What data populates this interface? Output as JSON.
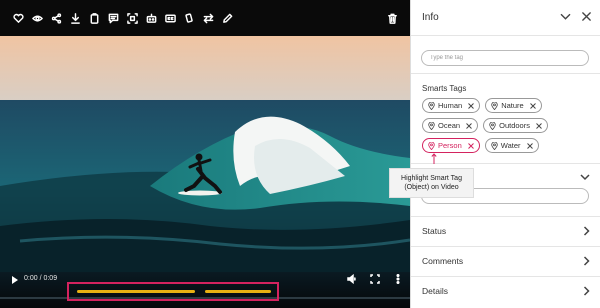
{
  "toolbar": {
    "icons": [
      "heart-icon",
      "eye-icon",
      "share-icon",
      "download-icon",
      "clipboard-icon",
      "comment-icon",
      "crop-icon",
      "bot-icon",
      "caption-icon",
      "rotate-icon",
      "swap-icon",
      "edit-icon",
      "trash-icon"
    ]
  },
  "player": {
    "time": "0:00 / 0:09",
    "accent": "#d4235f",
    "highlight_color": "#e7b012"
  },
  "info": {
    "title": "Info",
    "tag_placeholder": "Type the tag",
    "smart_tags_title": "Smarts Tags",
    "tags": [
      {
        "label": "Human",
        "active": false
      },
      {
        "label": "Nature",
        "active": false
      },
      {
        "label": "Ocean",
        "active": false
      },
      {
        "label": "Outdoors",
        "active": false
      },
      {
        "label": "Person",
        "active": true
      },
      {
        "label": "Water",
        "active": false
      }
    ],
    "tooltip": [
      "Highlight Smart Tag",
      "(Object) on Video"
    ],
    "sections": [
      "Status",
      "Comments",
      "Details"
    ]
  }
}
